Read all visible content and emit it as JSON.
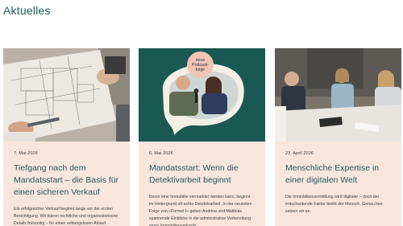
{
  "section": {
    "title": "Aktuelles"
  },
  "podcast_badge": {
    "line1": "neue",
    "line2": "Podcast-",
    "line3": "folge"
  },
  "cards": [
    {
      "date": "7. Mai 2026",
      "title": "Tiefgang nach dem Mandatsstart – die Basis für einen sicheren Verkauf",
      "excerpt": "Ein erfolgreicher Verkauf beginnt lange vor der ersten Besichtigung. Wir klären rechtliche und organisatorische Details frühzeitig – für einen reibungslosen Ablauf."
    },
    {
      "date": "6. Mai 2026",
      "title": "Mandatsstart: Wenn die Detektivarbeit beginnt",
      "excerpt": "Bevor eine Immobilie vermarktet werden kann, beginnt im Hintergrund oft echte Detektivarbeit. In der neuesten Folge von «Formel I» geben Andrina und Matthias spannende Einblicke in die administrative Vorbereitung eines Immobilienverkaufs."
    },
    {
      "date": "23. April 2026",
      "title": "Menschliche Expertise in einer digitalen Welt",
      "excerpt": "Die Immobilienvermittlung wird digitaler – doch der entscheidende Faktor bleibt der Mensch. Genau hier setzen wir an."
    }
  ],
  "colors": {
    "title": "#1f5b5b",
    "card_bg": "#f8e6dd",
    "podcast_bg": "#1a5853",
    "badge_bg": "#f2c4b3"
  },
  "icons": [
    "podcast-badge"
  ]
}
